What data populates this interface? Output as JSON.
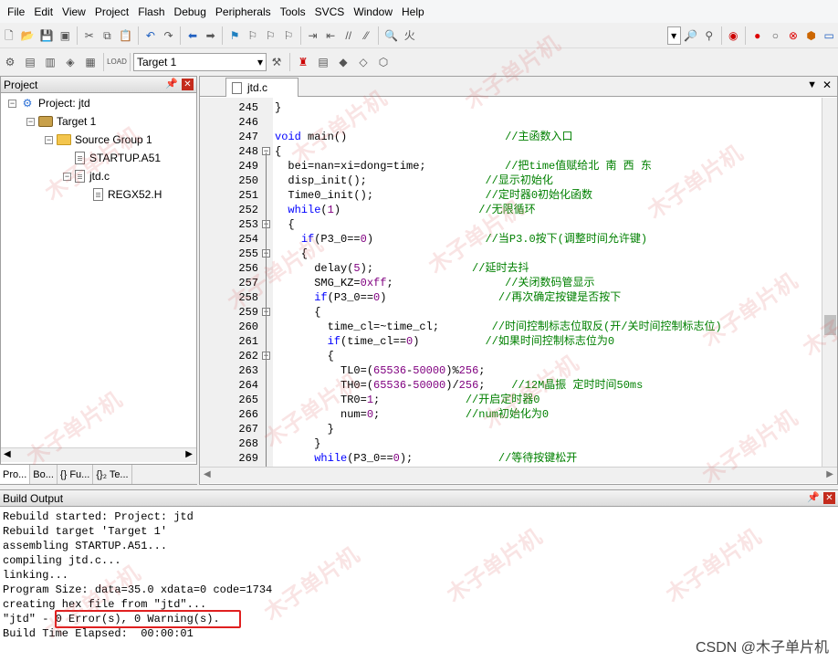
{
  "menu": [
    "File",
    "Edit",
    "View",
    "Project",
    "Flash",
    "Debug",
    "Peripherals",
    "Tools",
    "SVCS",
    "Window",
    "Help"
  ],
  "toolbar2": {
    "target_select": "Target 1"
  },
  "project_panel": {
    "title": "Project",
    "tree": [
      {
        "label": "Project: jtd",
        "level": 0,
        "kind": "project",
        "expander": "−"
      },
      {
        "label": "Target 1",
        "level": 1,
        "kind": "target",
        "expander": "−"
      },
      {
        "label": "Source Group 1",
        "level": 2,
        "kind": "folder",
        "expander": "−"
      },
      {
        "label": "STARTUP.A51",
        "level": 3,
        "kind": "file",
        "expander": ""
      },
      {
        "label": "jtd.c",
        "level": 3,
        "kind": "file",
        "expander": "−"
      },
      {
        "label": "REGX52.H",
        "level": 4,
        "kind": "file",
        "expander": ""
      }
    ],
    "tabs": [
      "Pro...",
      "Bo...",
      "{} Fu...",
      "{}₂ Te..."
    ]
  },
  "editor": {
    "tab": "jtd.c",
    "lines": [
      {
        "n": "245",
        "t": [
          {
            "c": "}",
            "s": ""
          }
        ]
      },
      {
        "n": "246",
        "t": []
      },
      {
        "n": "247",
        "t": [
          {
            "c": "void",
            "s": "kw"
          },
          {
            "c": " main()                        ",
            "s": ""
          },
          {
            "c": "//主函数入口",
            "s": "cm"
          }
        ]
      },
      {
        "n": "248",
        "t": [
          {
            "c": "{",
            "s": ""
          }
        ]
      },
      {
        "n": "249",
        "t": [
          {
            "c": "  bei=nan=xi=dong=time;            ",
            "s": ""
          },
          {
            "c": "//把time值赋给北 南 西 东",
            "s": "cm"
          }
        ]
      },
      {
        "n": "250",
        "t": [
          {
            "c": "  disp_init();                  ",
            "s": ""
          },
          {
            "c": "//显示初始化",
            "s": "cm"
          }
        ]
      },
      {
        "n": "251",
        "t": [
          {
            "c": "  Time0_init();                 ",
            "s": ""
          },
          {
            "c": "//定时器0初始化函数",
            "s": "cm"
          }
        ]
      },
      {
        "n": "252",
        "t": [
          {
            "c": "  ",
            "s": ""
          },
          {
            "c": "while",
            "s": "kw"
          },
          {
            "c": "(",
            "s": ""
          },
          {
            "c": "1",
            "s": "nm"
          },
          {
            "c": ")                     ",
            "s": ""
          },
          {
            "c": "//无限循环",
            "s": "cm"
          }
        ]
      },
      {
        "n": "253",
        "t": [
          {
            "c": "  {",
            "s": ""
          }
        ]
      },
      {
        "n": "254",
        "t": [
          {
            "c": "    ",
            "s": ""
          },
          {
            "c": "if",
            "s": "kw"
          },
          {
            "c": "(P3_0==",
            "s": ""
          },
          {
            "c": "0",
            "s": "nm"
          },
          {
            "c": ")                 ",
            "s": ""
          },
          {
            "c": "//当P3.0按下(调整时间允许键)",
            "s": "cm"
          }
        ]
      },
      {
        "n": "255",
        "t": [
          {
            "c": "    {",
            "s": ""
          }
        ]
      },
      {
        "n": "256",
        "t": [
          {
            "c": "      delay(",
            "s": ""
          },
          {
            "c": "5",
            "s": "nm"
          },
          {
            "c": ");               ",
            "s": ""
          },
          {
            "c": "//延时去抖",
            "s": "cm"
          }
        ]
      },
      {
        "n": "257",
        "t": [
          {
            "c": "      SMG_KZ=",
            "s": ""
          },
          {
            "c": "0xff",
            "s": "nm"
          },
          {
            "c": ";                 ",
            "s": ""
          },
          {
            "c": "//关闭数码管显示",
            "s": "cm"
          }
        ]
      },
      {
        "n": "258",
        "t": [
          {
            "c": "      ",
            "s": ""
          },
          {
            "c": "if",
            "s": "kw"
          },
          {
            "c": "(P3_0==",
            "s": ""
          },
          {
            "c": "0",
            "s": "nm"
          },
          {
            "c": ")                 ",
            "s": ""
          },
          {
            "c": "//再次确定按键是否按下",
            "s": "cm"
          }
        ]
      },
      {
        "n": "259",
        "t": [
          {
            "c": "      {",
            "s": ""
          }
        ]
      },
      {
        "n": "260",
        "t": [
          {
            "c": "        time_cl=~time_cl;        ",
            "s": ""
          },
          {
            "c": "//时间控制标志位取反(开/关时间控制标志位)",
            "s": "cm"
          }
        ]
      },
      {
        "n": "261",
        "t": [
          {
            "c": "        ",
            "s": ""
          },
          {
            "c": "if",
            "s": "kw"
          },
          {
            "c": "(time_cl==",
            "s": ""
          },
          {
            "c": "0",
            "s": "nm"
          },
          {
            "c": ")          ",
            "s": ""
          },
          {
            "c": "//如果时间控制标志位为0",
            "s": "cm"
          }
        ]
      },
      {
        "n": "262",
        "t": [
          {
            "c": "        {",
            "s": ""
          }
        ]
      },
      {
        "n": "263",
        "t": [
          {
            "c": "          TL0=(",
            "s": ""
          },
          {
            "c": "65536",
            "s": "nm"
          },
          {
            "c": "-",
            "s": ""
          },
          {
            "c": "50000",
            "s": "nm"
          },
          {
            "c": ")%",
            "s": ""
          },
          {
            "c": "256",
            "s": "nm"
          },
          {
            "c": ";",
            "s": ""
          }
        ]
      },
      {
        "n": "264",
        "t": [
          {
            "c": "          TH0=(",
            "s": ""
          },
          {
            "c": "65536",
            "s": "nm"
          },
          {
            "c": "-",
            "s": ""
          },
          {
            "c": "50000",
            "s": "nm"
          },
          {
            "c": ")/",
            "s": ""
          },
          {
            "c": "256",
            "s": "nm"
          },
          {
            "c": ";    ",
            "s": ""
          },
          {
            "c": "//12M晶振 定时时间50ms",
            "s": "cm"
          }
        ]
      },
      {
        "n": "265",
        "t": [
          {
            "c": "          TR0=",
            "s": ""
          },
          {
            "c": "1",
            "s": "nm"
          },
          {
            "c": ";             ",
            "s": ""
          },
          {
            "c": "//开启定时器0",
            "s": "cm"
          }
        ]
      },
      {
        "n": "266",
        "t": [
          {
            "c": "          num=",
            "s": ""
          },
          {
            "c": "0",
            "s": "nm"
          },
          {
            "c": ";             ",
            "s": ""
          },
          {
            "c": "//num初始化为0",
            "s": "cm"
          }
        ]
      },
      {
        "n": "267",
        "t": [
          {
            "c": "        }",
            "s": ""
          }
        ]
      },
      {
        "n": "268",
        "t": [
          {
            "c": "      }",
            "s": ""
          }
        ]
      },
      {
        "n": "269",
        "t": [
          {
            "c": "      ",
            "s": ""
          },
          {
            "c": "while",
            "s": "kw"
          },
          {
            "c": "(P3_0==",
            "s": ""
          },
          {
            "c": "0",
            "s": "nm"
          },
          {
            "c": ");             ",
            "s": ""
          },
          {
            "c": "//等待按键松开",
            "s": "cm"
          }
        ]
      }
    ]
  },
  "build_output": {
    "title": "Build Output",
    "lines": [
      "Rebuild started: Project: jtd",
      "Rebuild target 'Target 1'",
      "assembling STARTUP.A51...",
      "compiling jtd.c...",
      "linking...",
      "Program Size: data=35.0 xdata=0 code=1734",
      "creating hex file from \"jtd\"...",
      "\"jtd\" - 0 Error(s), 0 Warning(s).",
      "Build Time Elapsed:  00:00:01"
    ]
  },
  "watermark_text": "木子单片机",
  "credit": "CSDN @木子单片机",
  "colors": {
    "keyword": "#0000ff",
    "comment": "#008000",
    "number": "#800080",
    "highlight": "#e02020"
  }
}
